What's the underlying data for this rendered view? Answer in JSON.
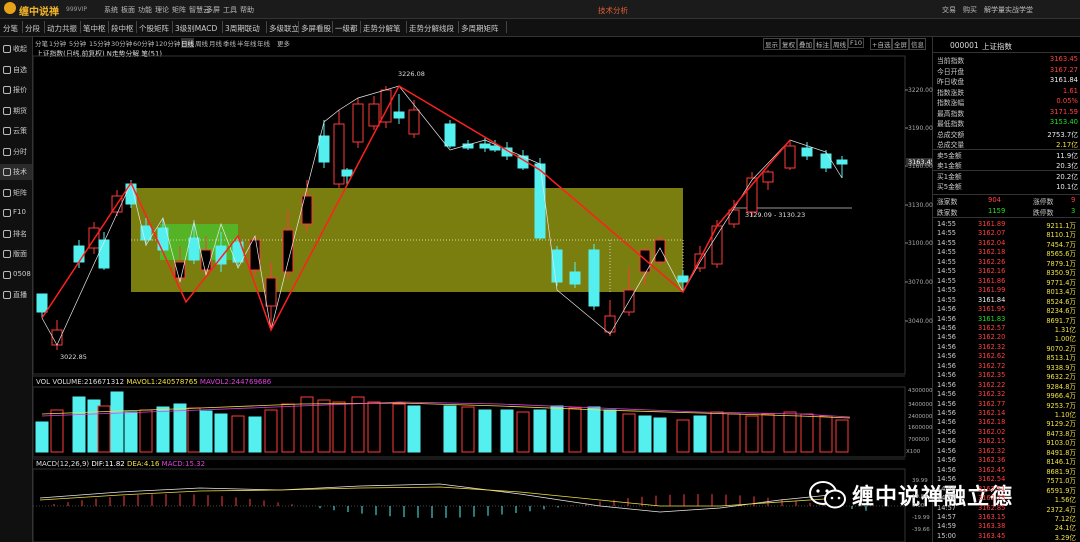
{
  "app": {
    "name": "缠中说禅",
    "version": "999VIP",
    "window_title": "技术分析"
  },
  "top_menu": [
    "系统",
    "板面",
    "功能",
    "理论",
    "矩阵",
    "智慧云",
    "多屏",
    "工具",
    "帮助"
  ],
  "top_right_menu": [
    "交易",
    "购买",
    "解学量",
    "实战学堂"
  ],
  "toolbar": [
    {
      "label": "分笔"
    },
    {
      "label": "分段"
    },
    {
      "label": "动力共振"
    },
    {
      "label": "笔中枢"
    },
    {
      "label": "段中枢"
    },
    {
      "label": "个股矩阵"
    },
    {
      "label": "3级别MACD"
    },
    {
      "label": "3周期联动"
    },
    {
      "label": "多级联立"
    },
    {
      "label": "多屏看股"
    },
    {
      "label": "一级都"
    },
    {
      "label": "走势分解笔"
    },
    {
      "label": "走势分解线段"
    },
    {
      "label": "多周期矩阵"
    }
  ],
  "left_nav": [
    {
      "label": "收起",
      "icon": "collapse-icon"
    },
    {
      "label": "自选",
      "icon": "star-icon"
    },
    {
      "label": "报价",
      "icon": "quote-icon"
    },
    {
      "label": "期货",
      "icon": "futures-icon"
    },
    {
      "label": "云策",
      "icon": "cloud-icon"
    },
    {
      "label": "分时",
      "icon": "clock-icon"
    },
    {
      "label": "技术",
      "icon": "candlestick-icon"
    },
    {
      "label": "矩阵",
      "icon": "matrix-icon"
    },
    {
      "label": "F10",
      "icon": "f10-icon"
    },
    {
      "label": "排名",
      "icon": "rank-icon"
    },
    {
      "label": "版面",
      "icon": "layout-icon"
    },
    {
      "label": "0508",
      "icon": "grid-icon"
    },
    {
      "label": "直播",
      "icon": "live-icon"
    }
  ],
  "period_tabs": [
    "分笔",
    "1分钟",
    "5分钟",
    "15分钟",
    "30分钟",
    "60分钟",
    "120分钟",
    "日线",
    "周线",
    "月线",
    "季线",
    "半年线",
    "年线",
    "更多"
  ],
  "active_period": "日线",
  "right_tools": [
    "显示",
    "复权",
    "叠加",
    "标注",
    "周线",
    "F10",
    "+自选",
    "全屏",
    "信息"
  ],
  "chart_title": "上证指数(日线,前复权) N走势分解 笔(51)",
  "price_axis": [
    "3220.00",
    "3190.00",
    "3160.00",
    "3130.00",
    "3100.00",
    "3070.00",
    "3040.00"
  ],
  "current_price_tag": "3163.45",
  "annotations": {
    "high": "3226.08",
    "low": "3022.85",
    "pivot_range": "3129.09 - 3130.23"
  },
  "volume": {
    "label": "VOL",
    "vol": "VOLUME:216671312",
    "ma1": "MAVOL1:240578765",
    "ma2": "MAVOL2:244769686",
    "axis": [
      "4300000",
      "3400000",
      "2400000",
      "1600000",
      "700000"
    ],
    "unit": "X100"
  },
  "macd": {
    "label": "MACD(12,26,9)",
    "dif": "DIF:11.82",
    "dea": "DEA:4.16",
    "macd": "MACD:15.32",
    "axis": [
      "39.99",
      "19.84",
      "0.00",
      "-19.99",
      "-39.66"
    ]
  },
  "quote": {
    "code": "000001",
    "name": "上证指数",
    "rows": [
      {
        "label": "当前指数",
        "value": "3163.45",
        "color": "red"
      },
      {
        "label": "今日开盘",
        "value": "3167.27",
        "color": "red"
      },
      {
        "label": "昨日收盘",
        "value": "3161.84",
        "color": "white"
      },
      {
        "label": "指数涨跌",
        "value": "1.61",
        "color": "red"
      },
      {
        "label": "指数涨幅",
        "value": "0.05%",
        "color": "red"
      },
      {
        "label": "最高指数",
        "value": "3171.59",
        "color": "red"
      },
      {
        "label": "最低指数",
        "value": "3153.40",
        "color": "green"
      },
      {
        "label": "总成交额",
        "value": "2753.7亿",
        "color": "white"
      },
      {
        "label": "总成交量",
        "value": "2.17亿",
        "color": "yellow"
      },
      {
        "label": "卖5金额",
        "value": "11.9亿",
        "color": "white"
      },
      {
        "label": "卖1金额",
        "value": "20.3亿",
        "color": "white"
      },
      {
        "label": "买1金额",
        "value": "20.2亿",
        "color": "white"
      },
      {
        "label": "买5金额",
        "value": "10.1亿",
        "color": "white"
      }
    ],
    "breadth": [
      {
        "l1": "涨家数",
        "v1": "904",
        "l2": "涨停数",
        "v2": "9"
      },
      {
        "l1": "跌家数",
        "v1": "1159",
        "l2": "跌停数",
        "v2": "3"
      }
    ]
  },
  "ticks": [
    {
      "t": "14:55",
      "p": "3161.89",
      "v": "9211.1万",
      "c": "red"
    },
    {
      "t": "14:55",
      "p": "3162.07",
      "v": "8110.1万",
      "c": "red"
    },
    {
      "t": "14:55",
      "p": "3162.04",
      "v": "7454.7万",
      "c": "red"
    },
    {
      "t": "14:55",
      "p": "3162.18",
      "v": "8565.6万",
      "c": "red"
    },
    {
      "t": "14:55",
      "p": "3162.26",
      "v": "7879.1万",
      "c": "red"
    },
    {
      "t": "14:55",
      "p": "3162.16",
      "v": "8350.9万",
      "c": "red"
    },
    {
      "t": "14:55",
      "p": "3161.86",
      "v": "9771.4万",
      "c": "red"
    },
    {
      "t": "14:55",
      "p": "3161.99",
      "v": "8013.4万",
      "c": "red"
    },
    {
      "t": "14:55",
      "p": "3161.84",
      "v": "8524.6万",
      "c": "white"
    },
    {
      "t": "14:56",
      "p": "3161.95",
      "v": "8234.6万",
      "c": "red"
    },
    {
      "t": "14:56",
      "p": "3161.83",
      "v": "8691.7万",
      "c": "green"
    },
    {
      "t": "14:56",
      "p": "3162.57",
      "v": "1.31亿",
      "c": "red"
    },
    {
      "t": "14:56",
      "p": "3162.20",
      "v": "1.00亿",
      "c": "red"
    },
    {
      "t": "14:56",
      "p": "3162.32",
      "v": "9070.2万",
      "c": "red"
    },
    {
      "t": "14:56",
      "p": "3162.62",
      "v": "8513.1万",
      "c": "red"
    },
    {
      "t": "14:56",
      "p": "3162.72",
      "v": "9338.9万",
      "c": "red"
    },
    {
      "t": "14:56",
      "p": "3162.35",
      "v": "9632.2万",
      "c": "red"
    },
    {
      "t": "14:56",
      "p": "3162.22",
      "v": "9284.8万",
      "c": "red"
    },
    {
      "t": "14:56",
      "p": "3162.32",
      "v": "9966.4万",
      "c": "red"
    },
    {
      "t": "14:56",
      "p": "3162.77",
      "v": "9253.7万",
      "c": "red"
    },
    {
      "t": "14:56",
      "p": "3162.14",
      "v": "1.10亿",
      "c": "red"
    },
    {
      "t": "14:56",
      "p": "3162.18",
      "v": "9129.2万",
      "c": "red"
    },
    {
      "t": "14:56",
      "p": "3162.02",
      "v": "8473.8万",
      "c": "red"
    },
    {
      "t": "14:56",
      "p": "3162.15",
      "v": "9103.0万",
      "c": "red"
    },
    {
      "t": "14:56",
      "p": "3162.32",
      "v": "8491.8万",
      "c": "red"
    },
    {
      "t": "14:56",
      "p": "3162.36",
      "v": "8146.1万",
      "c": "red"
    },
    {
      "t": "14:56",
      "p": "3162.45",
      "v": "8681.9万",
      "c": "red"
    },
    {
      "t": "14:56",
      "p": "3162.54",
      "v": "7571.0万",
      "c": "red"
    },
    {
      "t": "14:56",
      "p": "3162.51",
      "v": "6591.9万",
      "c": "red"
    },
    {
      "t": "14:56",
      "p": "3162.73",
      "v": "1.56亿",
      "c": "red"
    },
    {
      "t": "14:57",
      "p": "3162.85",
      "v": "2372.4万",
      "c": "red"
    },
    {
      "t": "14:57",
      "p": "3163.15",
      "v": "7.12亿",
      "c": "red"
    },
    {
      "t": "14:59",
      "p": "3163.38",
      "v": "24.1亿",
      "c": "red"
    },
    {
      "t": "15:00",
      "p": "3163.45",
      "v": "3.29亿",
      "c": "red"
    }
  ],
  "watermark": {
    "text": "缠中说禅融立德"
  }
}
